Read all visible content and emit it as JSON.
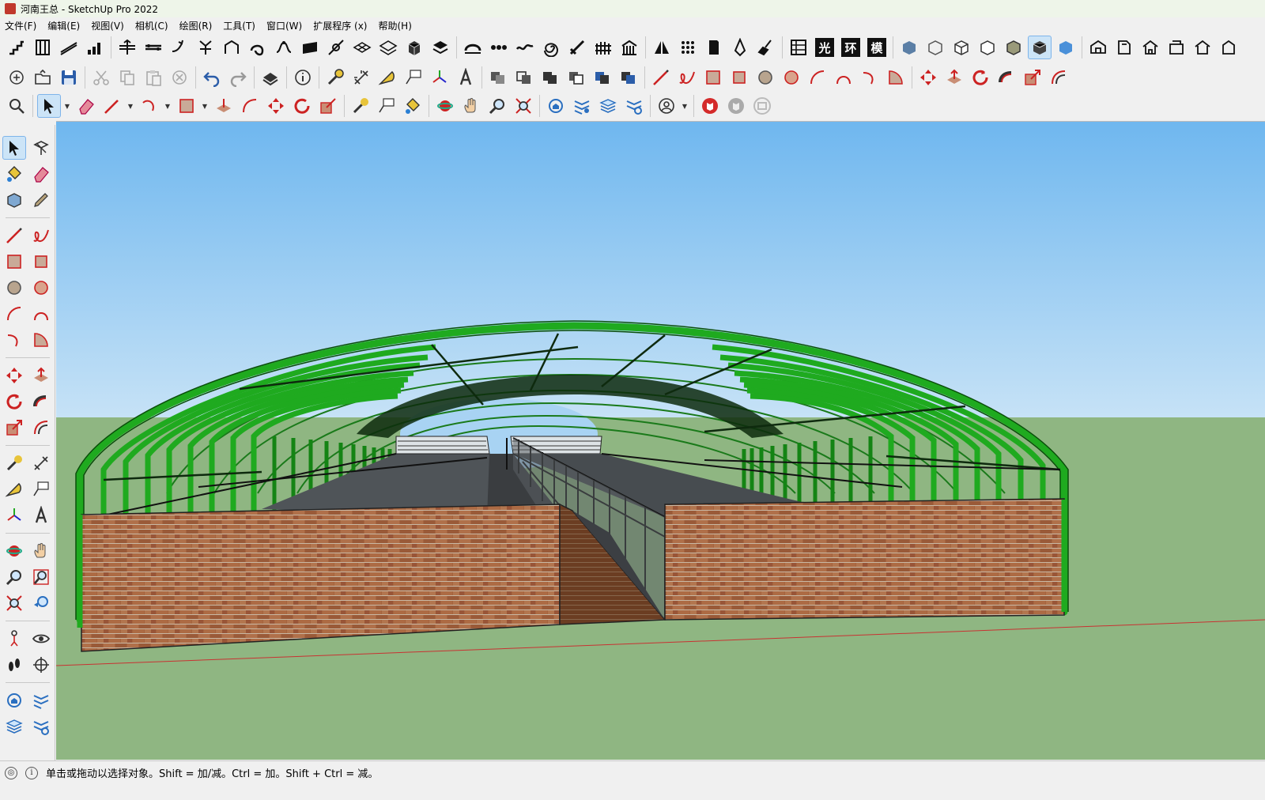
{
  "window": {
    "title": "河南王总 - SketchUp Pro 2022"
  },
  "menu": {
    "items": [
      "文件(F)",
      "编辑(E)",
      "视图(V)",
      "相机(C)",
      "绘图(R)",
      "工具(T)",
      "窗口(W)",
      "扩展程序 (x)",
      "帮助(H)"
    ]
  },
  "toolbar": {
    "render_letters": [
      "光",
      "环",
      "模"
    ]
  },
  "status": {
    "hint": "单击或拖动以选择对象。Shift = 加/减。Ctrl = 加。Shift + Ctrl = 减。"
  },
  "colors": {
    "sky_top": "#6fb7ef",
    "sky_bottom": "#c6e2f6",
    "ground": "#8fb682",
    "frame_green": "#1faa1f",
    "brick": "#a5643f"
  }
}
